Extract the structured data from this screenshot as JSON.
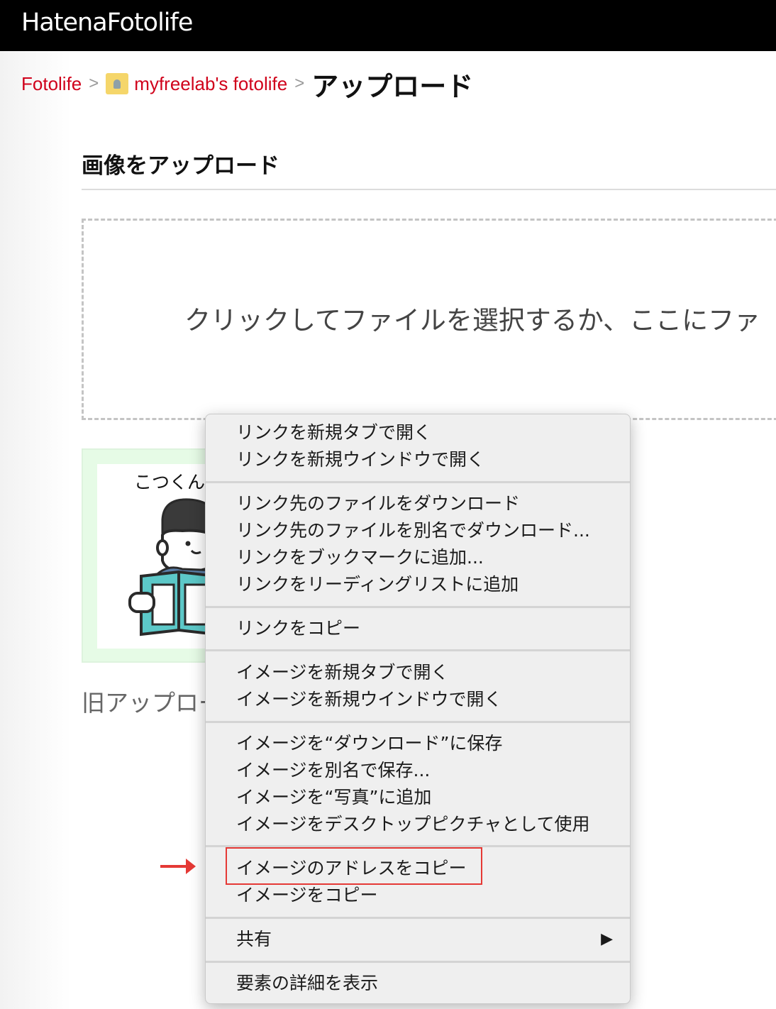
{
  "header": {
    "logo": "HatenaFotolife"
  },
  "breadcrumb": {
    "home": "Fotolife",
    "separator": ">",
    "user": "myfreelab's fotolife",
    "current": "アップロード"
  },
  "section": {
    "title": "画像をアップロード",
    "dropzone_text": "クリックしてファイルを選択するか、ここにファ"
  },
  "thumbnail": {
    "caption": "こつくん"
  },
  "old_upload_link": "旧アップロー",
  "context_menu": {
    "items": [
      "リンクを新規タブで開く",
      "リンクを新規ウインドウで開く",
      "リンク先のファイルをダウンロード",
      "リンク先のファイルを別名でダウンロード...",
      "リンクをブックマークに追加...",
      "リンクをリーディングリストに追加",
      "リンクをコピー",
      "イメージを新規タブで開く",
      "イメージを新規ウインドウで開く",
      "イメージを“ダウンロード”に保存",
      "イメージを別名で保存...",
      "イメージを“写真”に追加",
      "イメージをデスクトップピクチャとして使用",
      "イメージのアドレスをコピー",
      "イメージをコピー",
      "共有",
      "要素の詳細を表示"
    ],
    "submenu_arrow": "▶",
    "highlighted_item": "イメージのアドレスをコピー"
  },
  "colors": {
    "accent_link": "#d0021b",
    "highlight_annotation": "#e53935",
    "header_bg": "#000000"
  }
}
